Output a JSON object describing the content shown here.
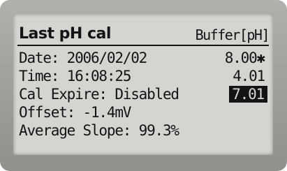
{
  "screen": {
    "title": "Last pH cal",
    "buffer_header": "Buffer[pH]",
    "lines": {
      "date": "Date: 2006/02/02",
      "time": "Time: 16:08:25",
      "cal_expire": "Cal Expire: Disabled",
      "offset": "Offset: -1.4mV",
      "slope": "Average Slope: 99.3%"
    },
    "buffers": [
      "8.00✱",
      "4.01",
      "7.01"
    ],
    "selected_buffer": "7.01"
  }
}
